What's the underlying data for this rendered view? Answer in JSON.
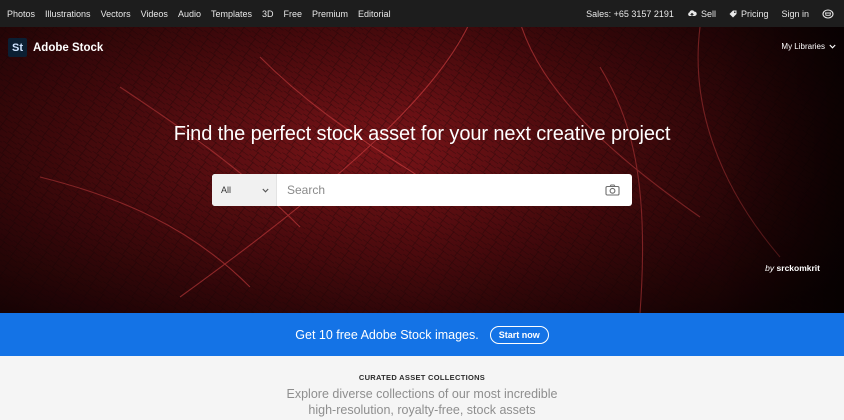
{
  "topnav": {
    "links": [
      "Photos",
      "Illustrations",
      "Vectors",
      "Videos",
      "Audio",
      "Templates",
      "3D",
      "Free",
      "Premium",
      "Editorial"
    ],
    "sales": "Sales: +65 3157 2191",
    "sell": "Sell",
    "pricing": "Pricing",
    "signin": "Sign in"
  },
  "brand": {
    "badge": "St",
    "name": "Adobe Stock"
  },
  "libraries": "My Libraries",
  "hero": {
    "headline": "Find the perfect stock asset for your next creative project",
    "credit_prefix": "by",
    "credit_author": "srckomkrit"
  },
  "search": {
    "category": "All",
    "placeholder": "Search"
  },
  "promo": {
    "message": "Get 10 free Adobe Stock images.",
    "button": "Start now"
  },
  "curated": {
    "eyebrow": "CURATED ASSET COLLECTIONS",
    "description": "Explore diverse collections of our most incredible high-resolution, royalty-free, stock assets"
  },
  "colors": {
    "nav_bg": "#1d1d1d",
    "promo_bg": "#1473e6",
    "hero_red": "#6e0d12"
  },
  "icons": [
    "sell-cloud-icon",
    "pricing-tag-icon",
    "cart-icon",
    "chevron-down-icon",
    "camera-icon"
  ]
}
